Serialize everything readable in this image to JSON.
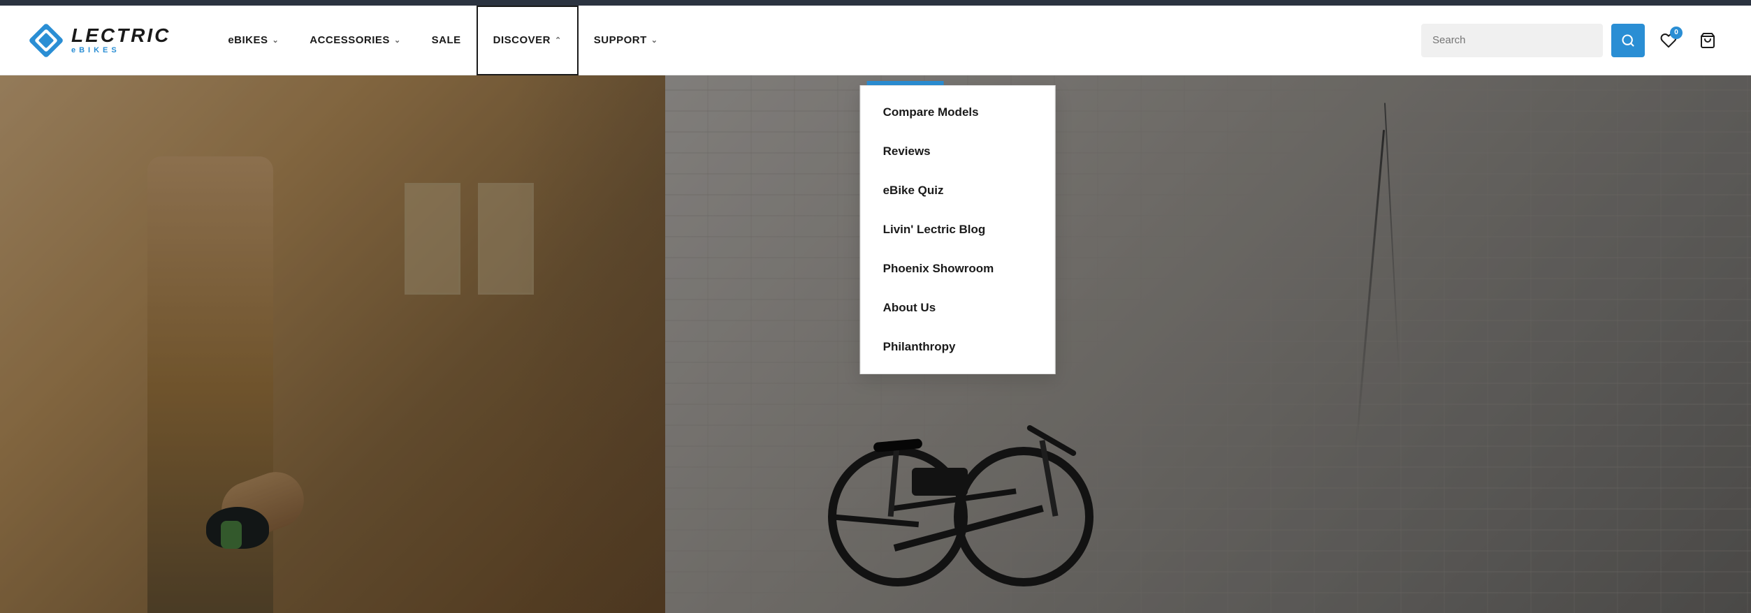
{
  "topBar": {},
  "header": {
    "logo": {
      "lectric": "LECTRIC",
      "ebikes": "eBIKES"
    },
    "nav": {
      "items": [
        {
          "label": "eBIKES",
          "hasDropdown": true,
          "active": false
        },
        {
          "label": "ACCESSORIES",
          "hasDropdown": true,
          "active": false
        },
        {
          "label": "SALE",
          "hasDropdown": false,
          "active": false
        },
        {
          "label": "DISCOVER",
          "hasDropdown": true,
          "active": true
        },
        {
          "label": "SUPPORT",
          "hasDropdown": true,
          "active": false
        }
      ]
    },
    "search": {
      "placeholder": "Search",
      "buttonLabel": "🔍"
    },
    "wishlistBadge": "0",
    "cartIcon": "🛒",
    "heartIcon": "♡"
  },
  "discover_dropdown": {
    "items": [
      {
        "label": "Compare Models"
      },
      {
        "label": "Reviews"
      },
      {
        "label": "eBike Quiz"
      },
      {
        "label": "Livin' Lectric Blog"
      },
      {
        "label": "Phoenix Showroom"
      },
      {
        "label": "About Us"
      },
      {
        "label": "Philanthropy"
      }
    ]
  },
  "hero": {
    "alt": "Person carrying bike helmet walking next to an electric bicycle"
  },
  "colors": {
    "brand_blue": "#2a8ed4",
    "dark": "#1a1a1a",
    "top_bar": "#2b3340"
  }
}
